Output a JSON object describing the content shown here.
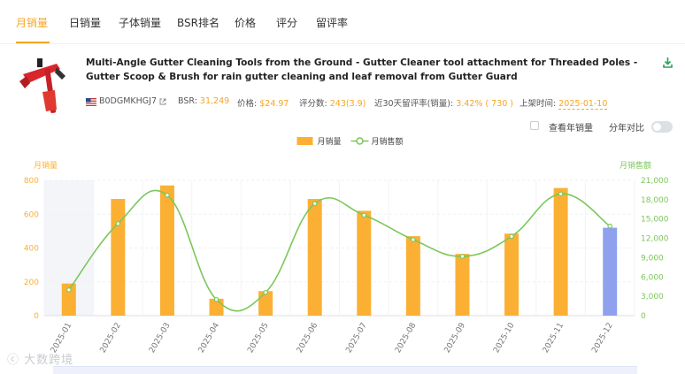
{
  "tabs": [
    {
      "label": "月销量",
      "active": true
    },
    {
      "label": "日销量"
    },
    {
      "label": "子体销量"
    },
    {
      "label": "BSR排名"
    },
    {
      "label": "价格"
    },
    {
      "label": "评分"
    },
    {
      "label": "留评率"
    }
  ],
  "product": {
    "title": "Multi-Angle Gutter Cleaning Tools from the Ground - Gutter Cleaner tool attachment for Threaded Poles - Gutter Scoop & Brush for rain gutter cleaning and leaf removal from Gutter Guard",
    "asin": "B0DGMKHGJ7",
    "bsr_label": "BSR: ",
    "bsr_value": "31,249",
    "price_label": "价格: ",
    "price_value": "$24.97",
    "rating_label": "评分数: ",
    "rating_value": "243(3.9)",
    "review_rate_label": "近30天留评率(销量): ",
    "review_rate_value": "3.42% ( 730 )",
    "launch_label": "上架时间: ",
    "launch_value": "2025-01-10"
  },
  "controls": {
    "year_view_label": "查看年销量",
    "yoy_label": "分年对比"
  },
  "colors": {
    "accent": "#f5a623",
    "bar": "#fbb034",
    "bar_highlight": "#8fa0ee",
    "line": "#7cc75a"
  },
  "watermark": "大数跨境",
  "chart_data": {
    "type": "bar",
    "categories": [
      "2025-01",
      "2025-02",
      "2025-03",
      "2025-04",
      "2025-05",
      "2025-06",
      "2025-07",
      "2025-08",
      "2025-09",
      "2025-10",
      "2025-11",
      "2025-12"
    ],
    "series": [
      {
        "name": "月销量",
        "type": "bar",
        "axis": "left",
        "values": [
          190,
          690,
          770,
          100,
          145,
          690,
          620,
          470,
          365,
          485,
          755,
          520
        ]
      },
      {
        "name": "月销售额",
        "type": "line",
        "axis": "right",
        "values": [
          4000,
          14300,
          18700,
          2500,
          3600,
          17400,
          15600,
          11800,
          9200,
          12300,
          18900,
          13900
        ]
      }
    ],
    "ylabel_left": "月销量",
    "ylabel_right": "月销售额",
    "ylim_left": [
      0,
      800
    ],
    "ylim_right": [
      0,
      21000
    ],
    "yticks_left": [
      "0",
      "200",
      "400",
      "600",
      "800"
    ],
    "yticks_right": [
      "0",
      "3,000",
      "6,000",
      "9,000",
      "12,000",
      "15,000",
      "18,000",
      "21,000"
    ],
    "legend_position": "top-center",
    "grid": true,
    "highlight_index": 11
  }
}
